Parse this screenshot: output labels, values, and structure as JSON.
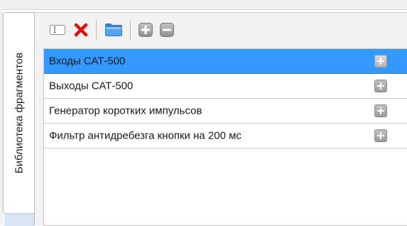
{
  "vertical_tab": {
    "label": "Библиотека фрагментов"
  },
  "toolbar": {
    "buttons": [
      {
        "icon": "rename-field-icon"
      },
      {
        "icon": "delete-x-icon",
        "color": "#e01010"
      },
      {
        "icon": "folder-icon",
        "color": "#2f7fd6"
      },
      {
        "icon": "expand-plus-icon"
      },
      {
        "icon": "collapse-minus-icon"
      }
    ]
  },
  "fragments": {
    "selected_index": 0,
    "items": [
      {
        "label": "Входы САТ-500"
      },
      {
        "label": "Выходы САТ-500"
      },
      {
        "label": "Генератор коротких импульсов"
      },
      {
        "label": "Фильтр антидребезга кнопки на 200 мс"
      }
    ]
  },
  "colors": {
    "selection": "#3399ff",
    "panel_bg": "#f2f2f2"
  }
}
